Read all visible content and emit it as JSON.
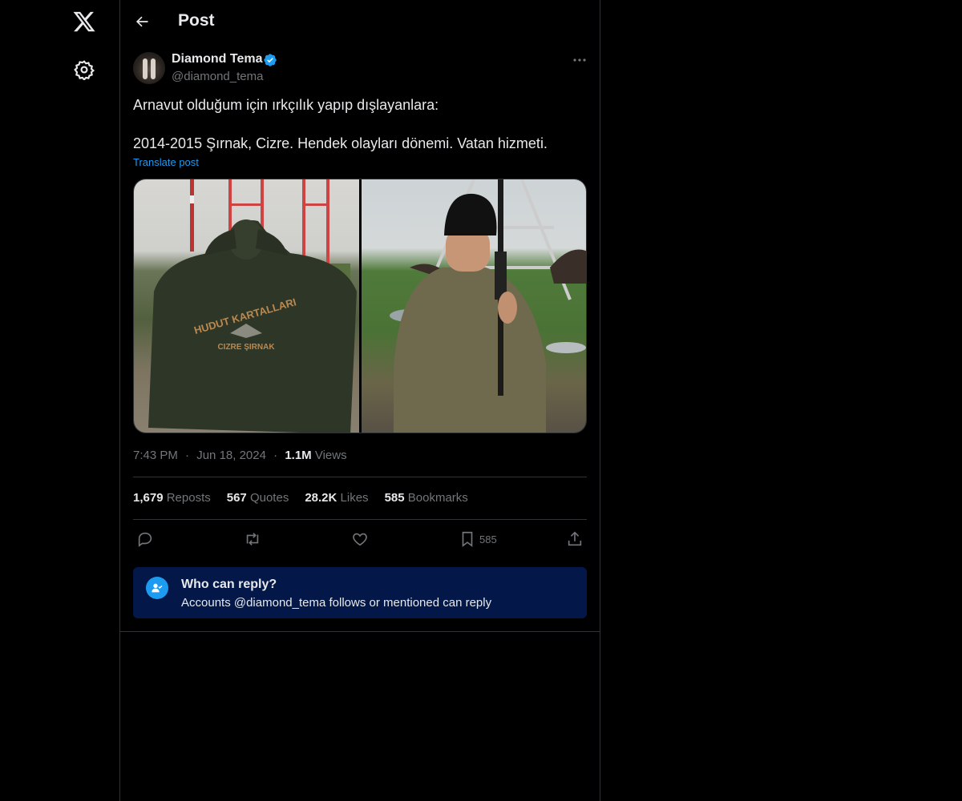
{
  "header": {
    "title": "Post"
  },
  "author": {
    "name": "Diamond Tema",
    "handle": "@diamond_tema",
    "verified": true
  },
  "tweet": {
    "line1": "Arnavut olduğum için ırkçılık yapıp dışlayanlara:",
    "line2": "2014-2015 Şırnak, Cizre. Hendek olayları dönemi. Vatan hizmeti.",
    "translate_label": "Translate post",
    "images": [
      {
        "name": "photo-hoodie-hudut-kartallari",
        "text": "HUDUT KARTALLARI CIZRE ŞIRNAK"
      },
      {
        "name": "photo-soldier-with-rifle"
      }
    ]
  },
  "meta": {
    "time": "7:43 PM",
    "date": "Jun 18, 2024",
    "sep": "·",
    "views_count": "1.1M",
    "views_label": "Views"
  },
  "stats": {
    "reposts_count": "1,679",
    "reposts_label": "Reposts",
    "quotes_count": "567",
    "quotes_label": "Quotes",
    "likes_count": "28.2K",
    "likes_label": "Likes",
    "bookmarks_count": "585",
    "bookmarks_label": "Bookmarks"
  },
  "actions": {
    "bookmark_count": "585"
  },
  "reply_restriction": {
    "title": "Who can reply?",
    "subtitle": "Accounts @diamond_tema follows or mentioned can reply"
  },
  "colors": {
    "accent": "#1d9bf0",
    "background": "#000000",
    "reply_box": "#031849"
  },
  "icons": [
    "x-logo-icon",
    "settings-icon",
    "back-arrow-icon",
    "verified-badge-icon",
    "more-options-icon",
    "reply-icon",
    "repost-icon",
    "like-icon",
    "bookmark-icon",
    "share-icon",
    "person-check-icon"
  ]
}
